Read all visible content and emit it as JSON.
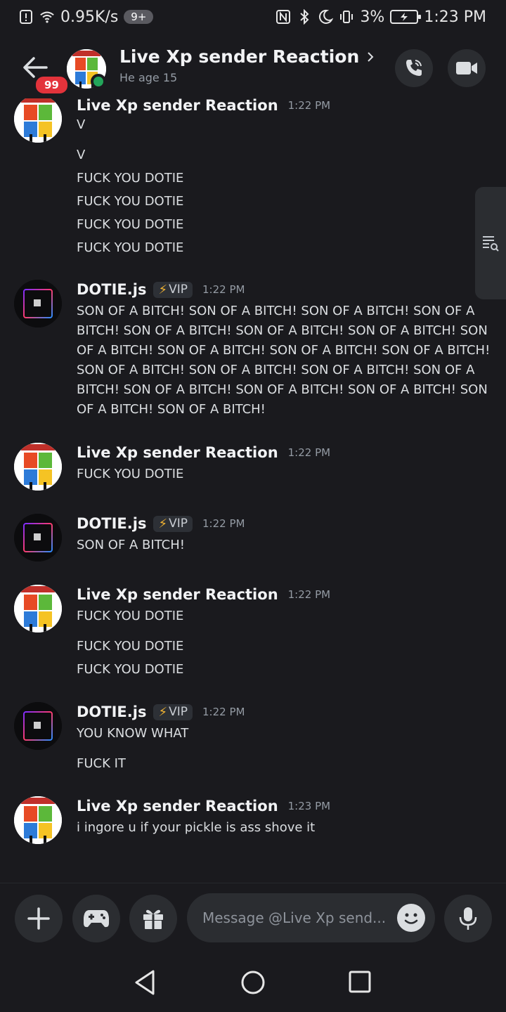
{
  "status_bar": {
    "net_speed": "0.95K/s",
    "notif_count": "9+",
    "battery": "3%",
    "time": "1:23 PM"
  },
  "header": {
    "back_badge": "99",
    "title": "Live Xp sender Reaction",
    "subtitle": "He age 15"
  },
  "messages": [
    {
      "author": "Live Xp sender Reaction",
      "time": "1:22 PM",
      "lines": [
        "V",
        "V",
        "FUCK YOU DOTIE",
        "FUCK YOU DOTIE",
        "FUCK YOU DOTIE",
        "FUCK YOU DOTIE"
      ]
    },
    {
      "author": "DOTIE.js",
      "vip": "VIP",
      "time": "1:22 PM",
      "lines": [
        "SON OF A BITCH! SON OF A BITCH! SON OF A BITCH! SON OF A BITCH! SON OF A BITCH! SON OF A BITCH! SON OF A BITCH! SON OF A BITCH! SON OF A BITCH! SON OF A BITCH! SON OF A BITCH! SON OF A BITCH! SON OF A BITCH! SON OF A BITCH! SON OF A BITCH! SON OF A BITCH! SON OF A BITCH! SON OF A BITCH! SON OF A BITCH! SON OF A BITCH!"
      ]
    },
    {
      "author": "Live Xp sender Reaction",
      "time": "1:22 PM",
      "lines": [
        "FUCK YOU DOTIE"
      ]
    },
    {
      "author": "DOTIE.js",
      "vip": "VIP",
      "time": "1:22 PM",
      "lines": [
        "SON OF A BITCH!"
      ]
    },
    {
      "author": "Live Xp sender Reaction",
      "time": "1:22 PM",
      "lines": [
        "FUCK YOU DOTIE",
        "FUCK YOU DOTIE",
        "FUCK YOU DOTIE"
      ]
    },
    {
      "author": "DOTIE.js",
      "vip": "VIP",
      "time": "1:22 PM",
      "lines": [
        "YOU KNOW WHAT",
        "FUCK IT"
      ]
    },
    {
      "author": "Live Xp sender Reaction",
      "time": "1:23 PM",
      "lines": [
        "i ingore u if your pickle is ass shove it"
      ]
    }
  ],
  "composer": {
    "placeholder": "Message @Live Xp send..."
  },
  "icons": {
    "back": "arrow-left-icon",
    "call": "phone-icon",
    "video": "video-camera-icon",
    "add": "plus-icon",
    "games": "gamepad-icon",
    "gift": "gift-icon",
    "emoji": "smiley-icon",
    "mic": "microphone-icon",
    "search_messages": "search-list-icon"
  },
  "colors": {
    "background": "#1a1a1e",
    "online": "#23a55a",
    "badge": "#e3333b",
    "vip_bolt": "#f0b232"
  }
}
